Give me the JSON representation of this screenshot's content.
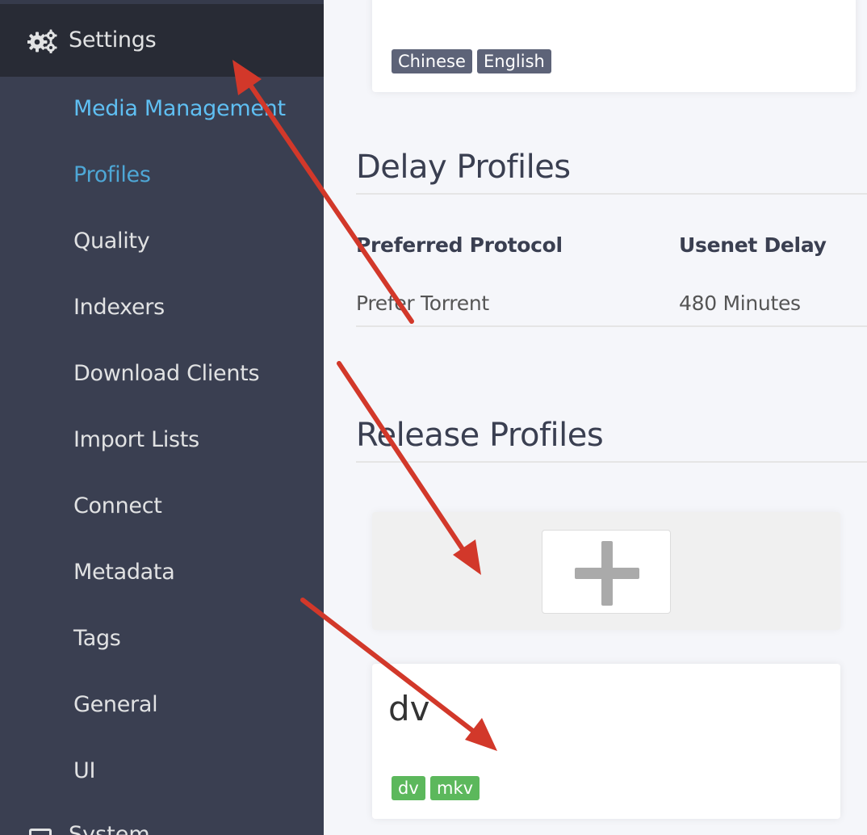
{
  "sidebar": {
    "settings_label": "Settings",
    "items": [
      {
        "label": "Media Management"
      },
      {
        "label": "Profiles"
      },
      {
        "label": "Quality"
      },
      {
        "label": "Indexers"
      },
      {
        "label": "Download Clients"
      },
      {
        "label": "Import Lists"
      },
      {
        "label": "Connect"
      },
      {
        "label": "Metadata"
      },
      {
        "label": "Tags"
      },
      {
        "label": "General"
      },
      {
        "label": "UI"
      }
    ],
    "system_label": "System"
  },
  "language_card": {
    "tags": [
      "Chinese",
      "English"
    ]
  },
  "delay_profiles": {
    "title": "Delay Profiles",
    "columns": [
      "Preferred Protocol",
      "Usenet Delay"
    ],
    "rows": [
      {
        "protocol": "Prefer Torrent",
        "usenet_delay": "480 Minutes"
      }
    ]
  },
  "release_profiles": {
    "title": "Release Profiles",
    "add_icon": "plus-icon",
    "profiles": [
      {
        "name": "dv",
        "tags": [
          "dv",
          "mkv"
        ]
      }
    ]
  },
  "colors": {
    "sidebar_bg": "#3a3f51",
    "header_bg": "#282b35",
    "link_highlight": "#5fbff2",
    "active_item": "#4ea7d6",
    "tag_gray": "#5d6378",
    "tag_green": "#5cb85c",
    "annotation_arrow": "#d2382a"
  }
}
